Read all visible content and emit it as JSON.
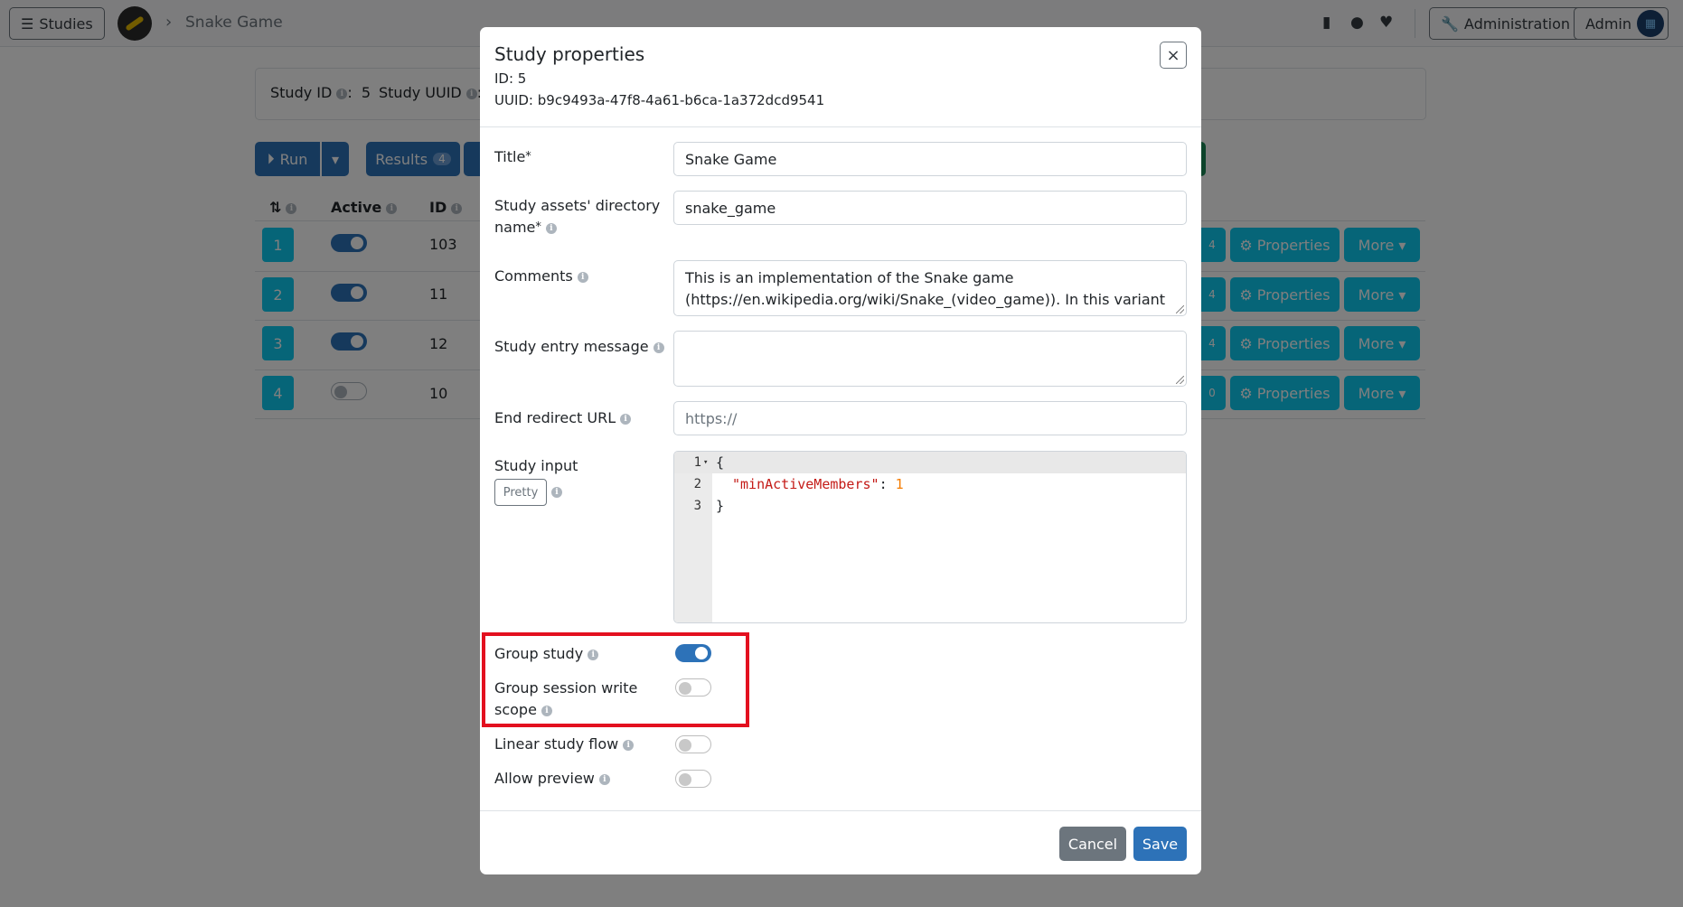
{
  "navbar": {
    "studies_label": "Studies",
    "breadcrumb": "Snake Game",
    "admin_label": "Administration",
    "user_label": "Admin"
  },
  "study_info": {
    "study_id_label": "Study ID",
    "study_id_value": "5",
    "study_uuid_label": "Study UUID"
  },
  "toolbar": {
    "run_label": "Run",
    "results_label": "Results",
    "results_count": "4"
  },
  "components_table": {
    "headers": [
      "",
      "Active",
      "ID"
    ],
    "rows": [
      {
        "position": "1",
        "active": true,
        "id": "103"
      },
      {
        "position": "2",
        "active": true,
        "id": "11"
      },
      {
        "position": "3",
        "active": true,
        "id": "12"
      },
      {
        "position": "4",
        "active": false,
        "id": "10"
      }
    ],
    "properties_label": "Properties",
    "more_label": "More"
  },
  "modal": {
    "title": "Study properties",
    "id_line": "ID: 5",
    "uuid_line": "UUID: b9c9493a-47f8-4a61-b6ca-1a372dcd9541",
    "fields": {
      "title": {
        "label": "Title",
        "value": "Snake Game"
      },
      "assets_dir": {
        "label_line1": "Study assets' directory",
        "label_line2": "name",
        "value": "snake_game"
      },
      "comments": {
        "label": "Comments",
        "value": "This is an implementation of the Snake game (https://en.wikipedia.org/wiki/Snake_(video_game)). In this variant  one can play against several other"
      },
      "entry_message": {
        "label": "Study entry message",
        "value": ""
      },
      "end_redirect": {
        "label": "End redirect URL",
        "placeholder": "https://"
      },
      "study_input": {
        "label": "Study input",
        "pretty_label": "Pretty",
        "lines": [
          "1",
          "2",
          "3"
        ],
        "open_brace": "{",
        "key": "\"minActiveMembers\"",
        "colon": ": ",
        "value": "1",
        "close_brace": "}"
      }
    },
    "toggles": {
      "group_study": {
        "label": "Group study",
        "on": true
      },
      "group_session_write_scope": {
        "label_line1": "Group session write",
        "label_line2": "scope",
        "on": false
      },
      "linear_study_flow": {
        "label": "Linear study flow",
        "on": false
      },
      "allow_preview": {
        "label": "Allow preview",
        "on": false
      }
    },
    "cancel_label": "Cancel",
    "save_label": "Save"
  },
  "colors": {
    "primary": "#2d72b8",
    "secondary": "#6c757d",
    "info": "#0dcaf0",
    "highlight": "#e3101f"
  }
}
